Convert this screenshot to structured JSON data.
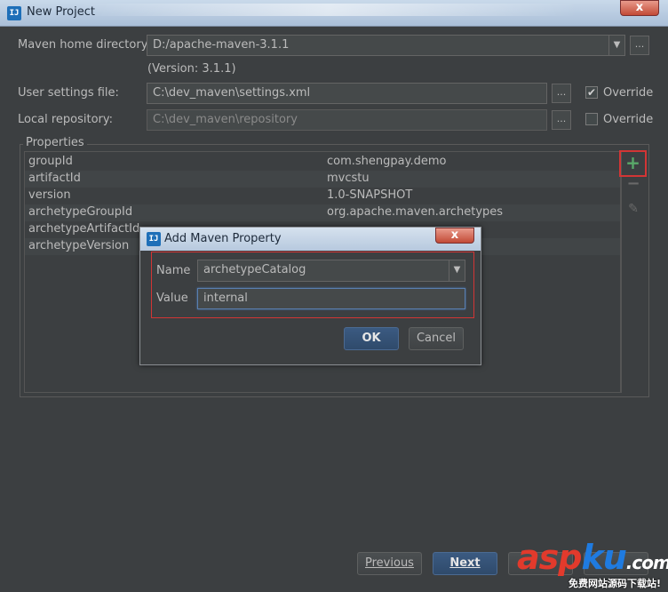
{
  "window": {
    "title": "New Project",
    "close_glyph": "x",
    "icon": "intellij-icon"
  },
  "form": {
    "maven_home_label": "Maven home directory:",
    "maven_home_value": "D:/apache-maven-3.1.1",
    "version_note": "(Version: 3.1.1)",
    "user_settings_label": "User settings file:",
    "user_settings_value": "C:\\dev_maven\\settings.xml",
    "user_settings_override_label": "Override",
    "user_settings_override_checked": true,
    "local_repo_label": "Local repository:",
    "local_repo_value": "C:\\dev_maven\\repository",
    "local_repo_override_label": "Override",
    "local_repo_override_checked": false,
    "browse_glyph": "..."
  },
  "properties": {
    "title": "Properties",
    "rows": [
      {
        "key": "groupId",
        "value": "com.shengpay.demo"
      },
      {
        "key": "artifactId",
        "value": "mvcstu"
      },
      {
        "key": "version",
        "value": "1.0-SNAPSHOT"
      },
      {
        "key": "archetypeGroupId",
        "value": "org.apache.maven.archetypes"
      },
      {
        "key": "archetypeArtifactId",
        "value": ""
      },
      {
        "key": "archetypeVersion",
        "value": ""
      }
    ],
    "tools": {
      "add": "+",
      "remove": "−",
      "edit": "✎"
    }
  },
  "dialog": {
    "title": "Add Maven Property",
    "name_label": "Name",
    "name_value": "archetypeCatalog",
    "value_label": "Value",
    "value_value": "internal",
    "ok_label": "OK",
    "cancel_label": "Cancel",
    "close_glyph": "x"
  },
  "footer": {
    "previous_label": "Previous",
    "next_label": "Next"
  },
  "watermark": {
    "text_a": "asp",
    "text_b": "ku",
    "text_c": ".com",
    "subtitle": "免费网站源码下载站!"
  },
  "colors": {
    "background": "#3c3f41",
    "accent_red": "#d23535",
    "add_green": "#59a869",
    "primary_button": "#3b5a81"
  }
}
